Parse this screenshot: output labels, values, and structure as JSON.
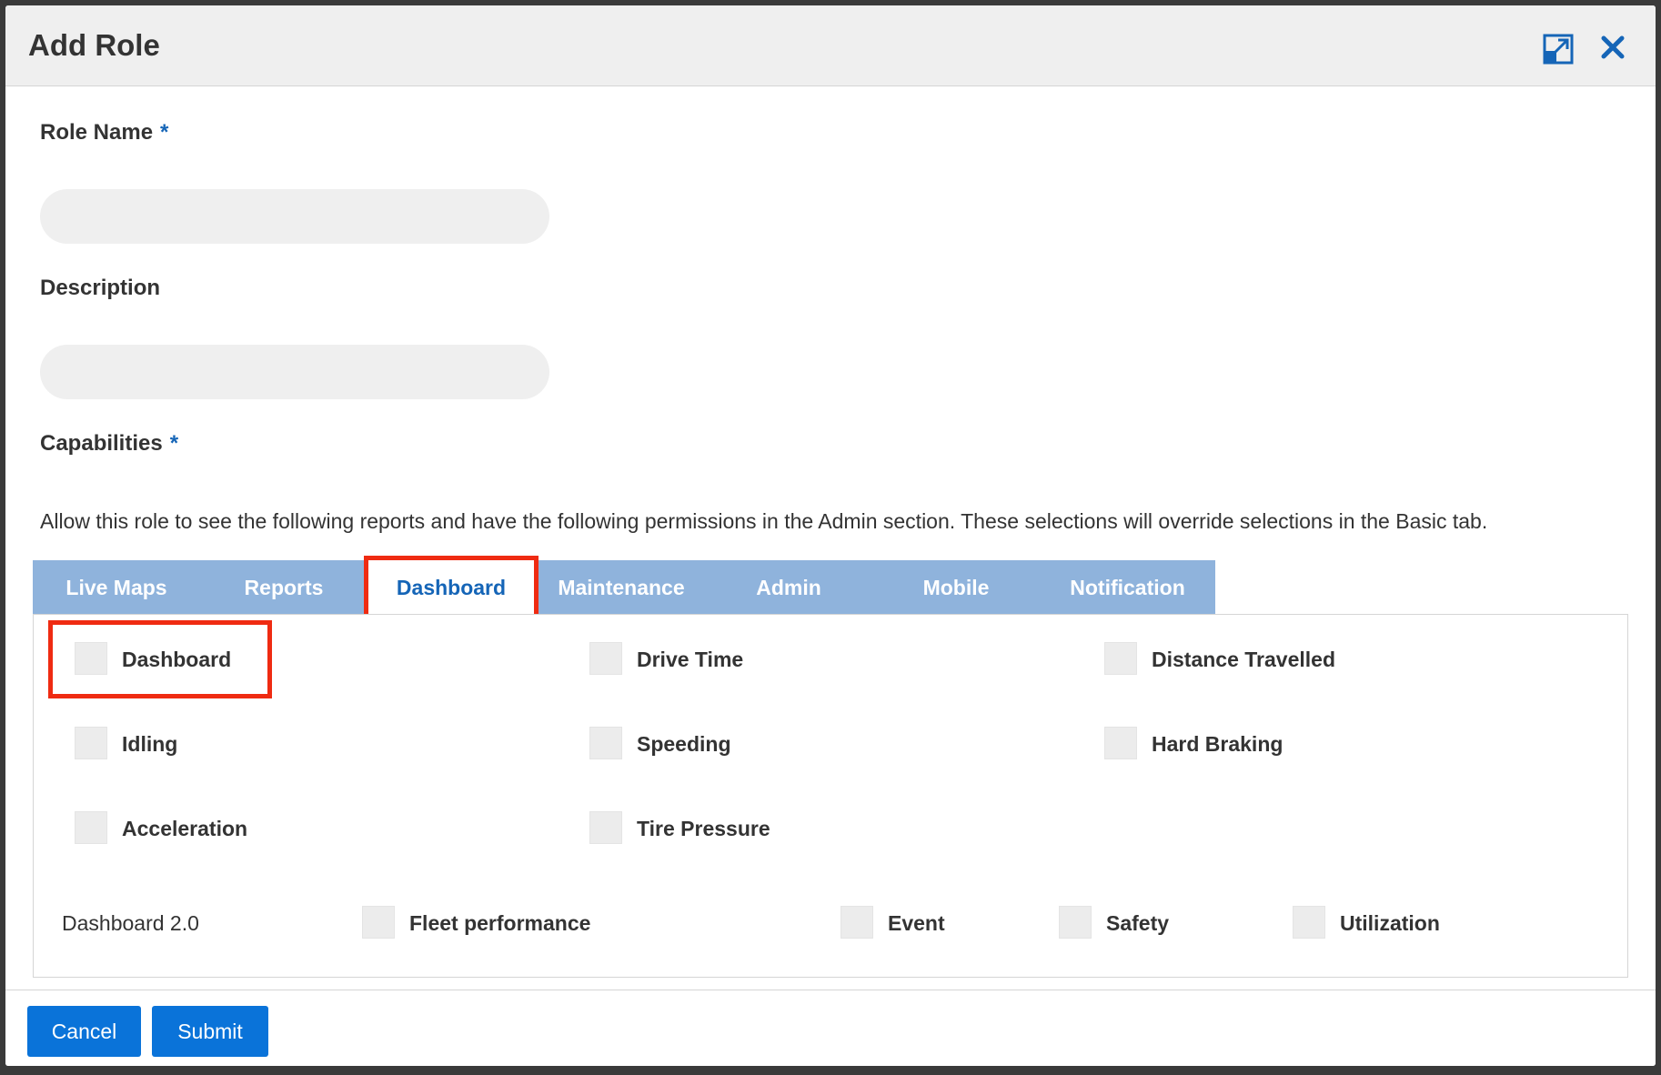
{
  "modal": {
    "title": "Add Role",
    "expand_icon": "expand-icon",
    "close_icon": "close-icon"
  },
  "form": {
    "role_name_label": "Role Name",
    "role_name_required": "*",
    "role_name_value": "",
    "description_label": "Description",
    "description_value": "",
    "capabilities_label": "Capabilities",
    "capabilities_required": "*",
    "capabilities_description": "Allow this role to see the following reports and have the following permissions in the Admin section. These selections will override selections in the Basic tab."
  },
  "tabs": [
    {
      "label": "Live Maps",
      "active": false
    },
    {
      "label": "Reports",
      "active": false
    },
    {
      "label": "Dashboard",
      "active": true
    },
    {
      "label": "Maintenance",
      "active": false
    },
    {
      "label": "Admin",
      "active": false
    },
    {
      "label": "Mobile",
      "active": false
    },
    {
      "label": "Notification",
      "active": false
    }
  ],
  "dashboard_panel": {
    "items": [
      {
        "label": "Dashboard",
        "checked": false
      },
      {
        "label": "Drive Time",
        "checked": false
      },
      {
        "label": "Distance Travelled",
        "checked": false
      },
      {
        "label": "Idling",
        "checked": false
      },
      {
        "label": "Speeding",
        "checked": false
      },
      {
        "label": "Hard Braking",
        "checked": false
      },
      {
        "label": "Acceleration",
        "checked": false
      },
      {
        "label": "Tire Pressure",
        "checked": false
      }
    ],
    "dashboard2": {
      "label": "Dashboard 2.0",
      "items": [
        {
          "label": "Fleet performance",
          "checked": false
        },
        {
          "label": "Event",
          "checked": false
        },
        {
          "label": "Safety",
          "checked": false
        },
        {
          "label": "Utilization",
          "checked": false
        }
      ]
    }
  },
  "footer": {
    "cancel_label": "Cancel",
    "submit_label": "Submit"
  },
  "colors": {
    "accent": "#1565b7",
    "button": "#0a73d9",
    "tab_bar": "#8fb3dc",
    "highlight": "#ef2b12"
  }
}
